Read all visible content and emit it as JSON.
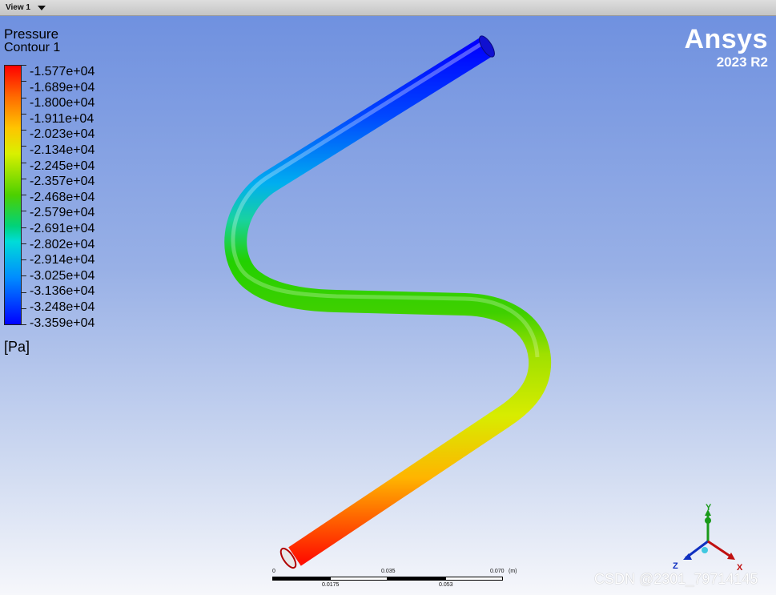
{
  "window": {
    "view_label": "View 1"
  },
  "legend": {
    "title": "Pressure",
    "subtitle": "Contour 1",
    "values": [
      "-1.577e+04",
      "-1.689e+04",
      "-1.800e+04",
      "-1.911e+04",
      "-2.023e+04",
      "-2.134e+04",
      "-2.245e+04",
      "-2.357e+04",
      "-2.468e+04",
      "-2.579e+04",
      "-2.691e+04",
      "-2.802e+04",
      "-2.914e+04",
      "-3.025e+04",
      "-3.136e+04",
      "-3.248e+04",
      "-3.359e+04"
    ],
    "unit": "[Pa]",
    "colors": [
      "#ff0000",
      "#ff6a00",
      "#ffc400",
      "#d9f000",
      "#4cd000",
      "#00d27a",
      "#00dcd8",
      "#008cff",
      "#0000ff"
    ]
  },
  "brand": {
    "name": "Ansys",
    "version": "2023 R2"
  },
  "axes": {
    "y": "Y",
    "z": "Z",
    "x": "X"
  },
  "scale": {
    "top_labels": [
      "0",
      "0.035",
      "0.070"
    ],
    "unit": "(m)",
    "bottom_labels": [
      "0.0175",
      "0.053"
    ]
  },
  "watermark": "CSDN @2301_79714145"
}
